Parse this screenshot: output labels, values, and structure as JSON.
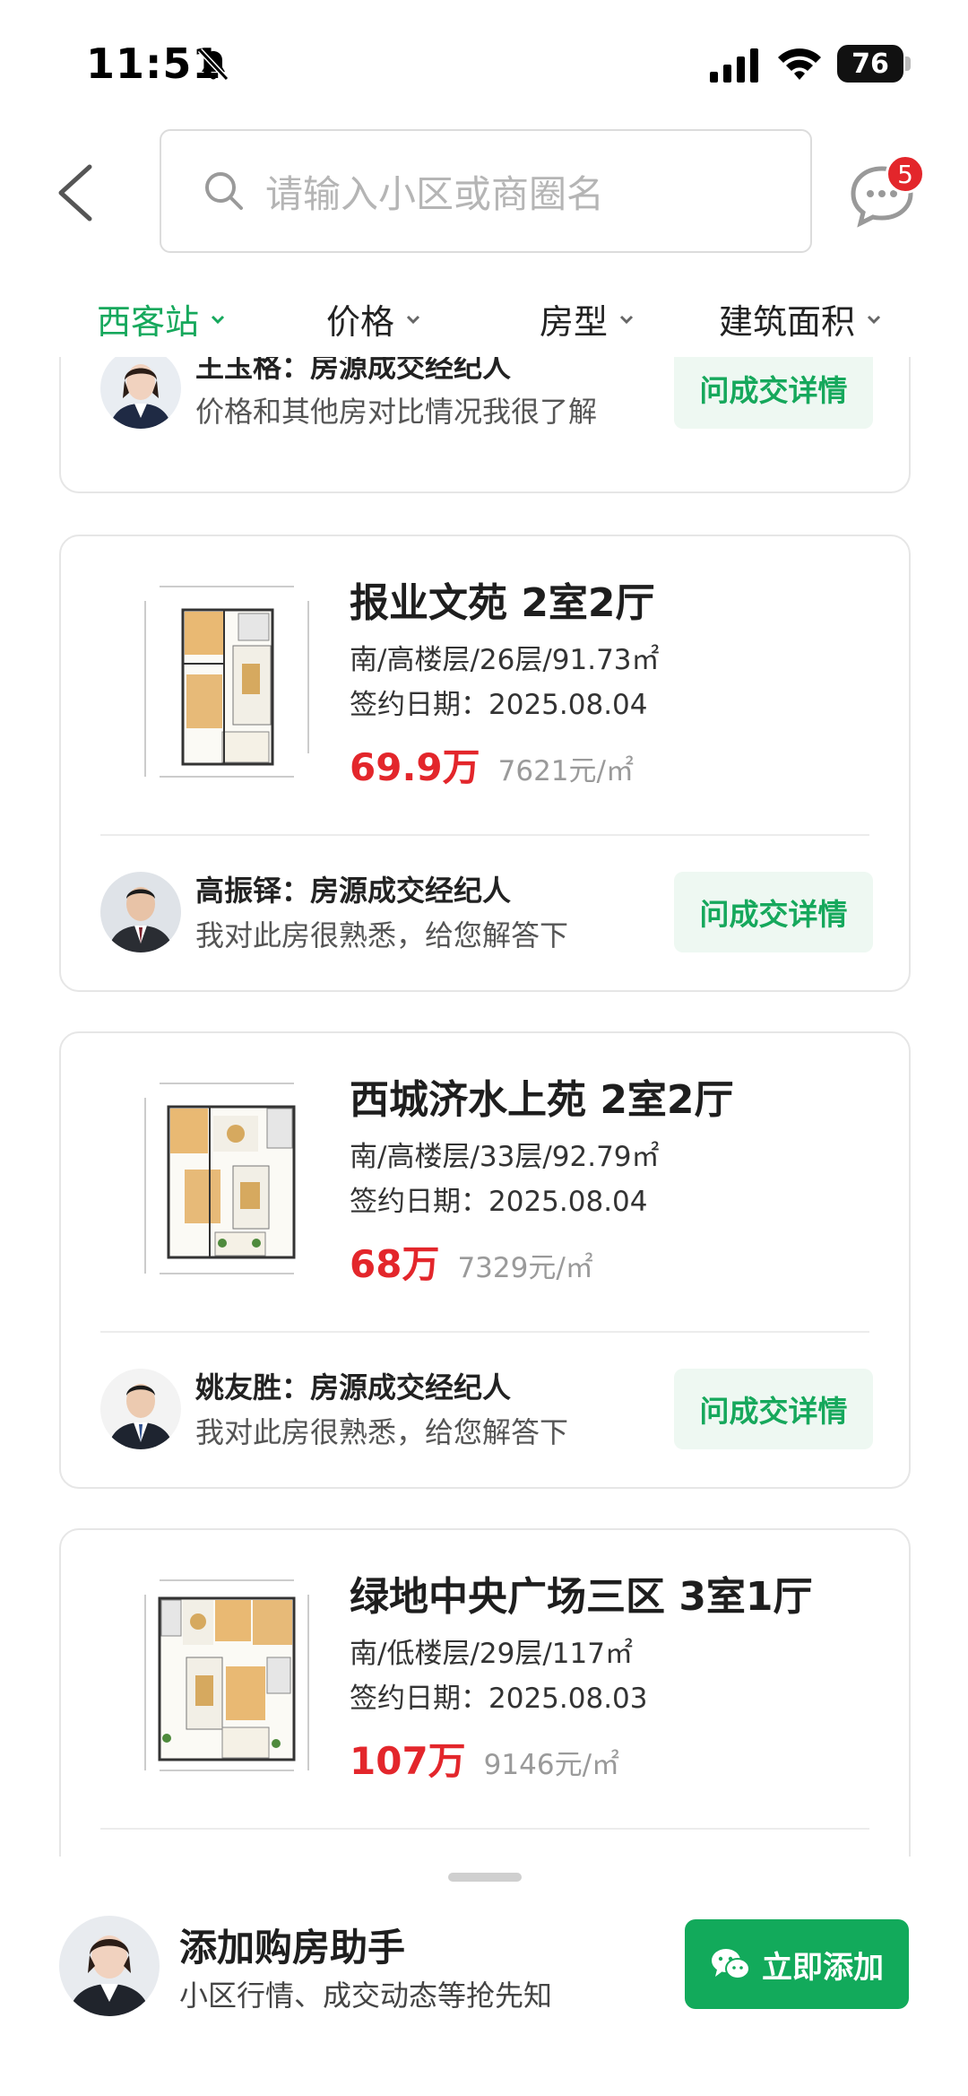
{
  "status_bar": {
    "time": "11:51",
    "battery": "76"
  },
  "header": {
    "search_placeholder": "请输入小区或商圈名",
    "message_badge": "5"
  },
  "filters": [
    {
      "label": "西客站",
      "active": true
    },
    {
      "label": "价格",
      "active": false
    },
    {
      "label": "房型",
      "active": false
    },
    {
      "label": "建筑面积",
      "active": false
    }
  ],
  "cards": [
    {
      "agent_name": "王玉格：房源成交经纪人",
      "agent_desc": "价格和其他房对比情况我很了解",
      "ask_label": "问成交详情"
    },
    {
      "title": "报业文苑 2室2厅",
      "info": "南/高楼层/26层/91.73㎡",
      "date": "签约日期：2025.08.04",
      "price": "69.9万",
      "unit_price": "7621元/㎡",
      "agent_name": "高振铎：房源成交经纪人",
      "agent_desc": "我对此房很熟悉，给您解答下",
      "ask_label": "问成交详情"
    },
    {
      "title": "西城济水上苑 2室2厅",
      "info": "南/高楼层/33层/92.79㎡",
      "date": "签约日期：2025.08.04",
      "price": "68万",
      "unit_price": "7329元/㎡",
      "agent_name": "姚友胜：房源成交经纪人",
      "agent_desc": "我对此房很熟悉，给您解答下",
      "ask_label": "问成交详情"
    },
    {
      "title": "绿地中央广场三区 3室1厅",
      "info": "南/低楼层/29层/117㎡",
      "date": "签约日期：2025.08.03",
      "price": "107万",
      "unit_price": "9146元/㎡"
    }
  ],
  "bottom_bar": {
    "title": "添加购房助手",
    "subtitle": "小区行情、成交动态等抢先知",
    "button_label": "立即添加"
  },
  "colors": {
    "accent_green": "#16a85c",
    "price_red": "#e3262b",
    "button_green": "#12aa5b"
  }
}
